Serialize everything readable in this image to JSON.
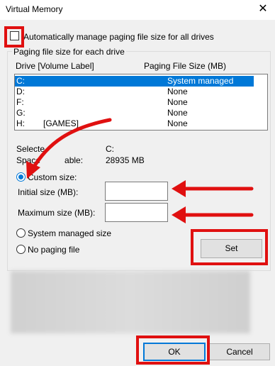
{
  "window": {
    "title": "Virtual Memory",
    "close_glyph": "✕"
  },
  "auto_manage": {
    "label": "Automatically manage paging file size for all drives",
    "checked": false
  },
  "group": {
    "legend": "Paging file size for each drive",
    "columns": {
      "drive": "Drive  [Volume Label]",
      "size": "Paging File Size (MB)"
    },
    "rows": [
      {
        "drive": "C:",
        "label": "",
        "size": "System managed",
        "selected": true
      },
      {
        "drive": "D:",
        "label": "",
        "size": "None",
        "selected": false
      },
      {
        "drive": "F:",
        "label": "",
        "size": "None",
        "selected": false
      },
      {
        "drive": "G:",
        "label": "",
        "size": "None",
        "selected": false
      },
      {
        "drive": "H:",
        "label": "[GAMES]",
        "size": "None",
        "selected": false
      }
    ]
  },
  "selected_drive": {
    "label": "Selecte",
    "value": "C:"
  },
  "space": {
    "label": "Space",
    "value2": "able:",
    "value": "28935 MB"
  },
  "custom_size": {
    "label": "Custom size:",
    "checked": true
  },
  "initial_size": {
    "label": "Initial size (MB):",
    "value": ""
  },
  "maximum_size": {
    "label": "Maximum size (MB):",
    "value": ""
  },
  "system_managed": {
    "label": "System managed size",
    "checked": false
  },
  "no_paging": {
    "label": "No paging file",
    "checked": false
  },
  "buttons": {
    "set": "Set",
    "ok": "OK",
    "cancel": "Cancel"
  },
  "colors": {
    "highlight_red": "#e01010",
    "selection_blue": "#0078d7"
  }
}
